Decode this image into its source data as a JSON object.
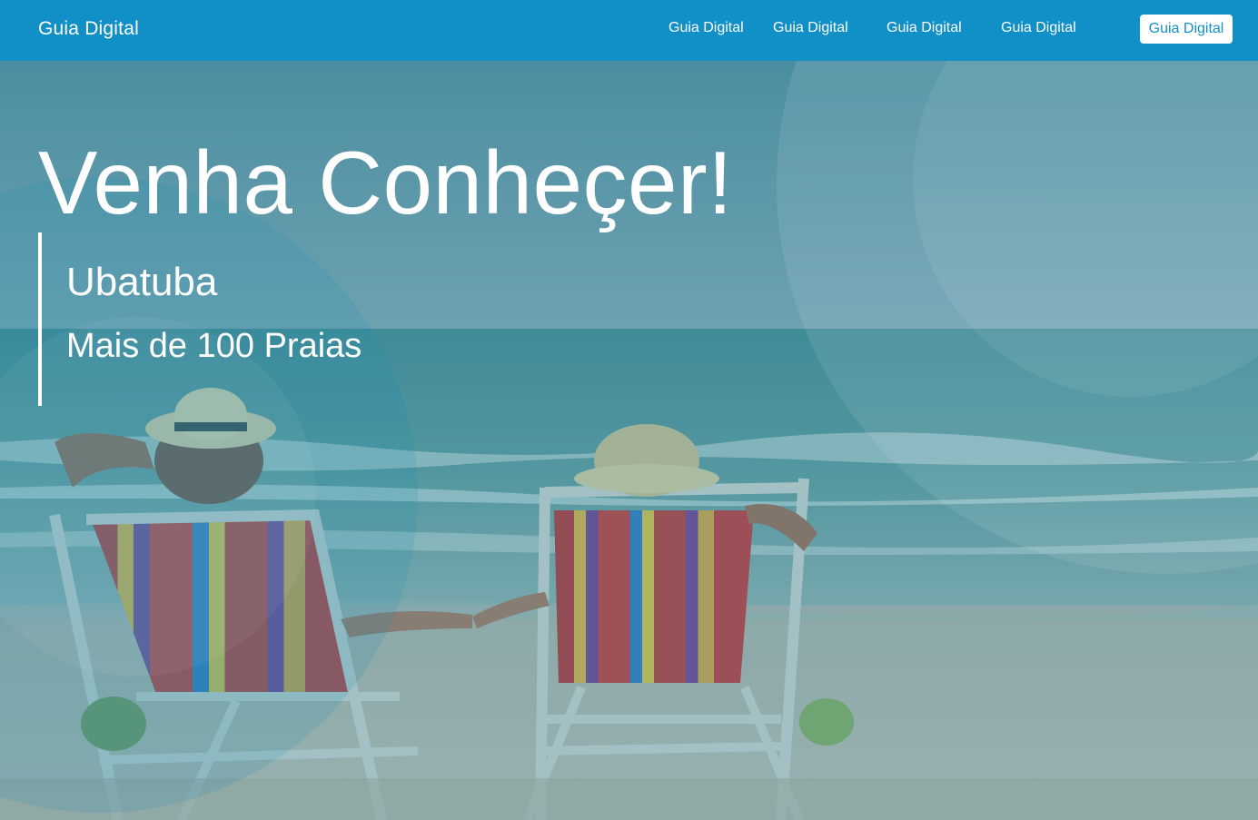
{
  "navbar": {
    "brand": "Guia Digital",
    "links": [
      "Guia Digital",
      "Guia Digital",
      "Guia Digital",
      "Guia Digital"
    ],
    "cta_label": "Guia Digital"
  },
  "hero": {
    "headline": "Venha Conheçer!",
    "subtitle": "Ubatuba",
    "tagline": "Mais de 100 Praias",
    "image_description_icon": "beach-photo"
  },
  "colors": {
    "navbar_bg": "#1190c8",
    "cta_bg": "#ffffff",
    "cta_text": "#1190c8",
    "hero_overlay": "#1a8fb5"
  }
}
